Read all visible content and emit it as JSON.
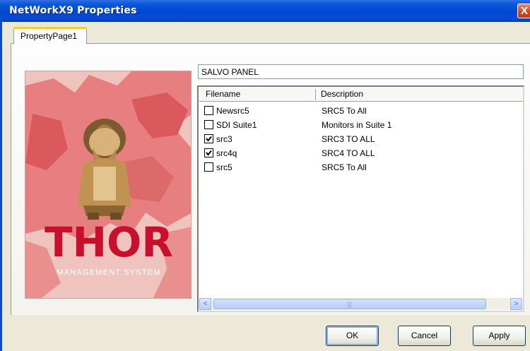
{
  "window": {
    "title": "NetWorkX9 Properties",
    "close_glyph": "X"
  },
  "tabs": [
    {
      "label": "PropertyPage1"
    }
  ],
  "logo": {
    "brand": "THOR",
    "tagline": "MANAGEMENT SYSTEM"
  },
  "panel_title": "SALVO PANEL",
  "list": {
    "columns": [
      "Filename",
      "Description"
    ],
    "rows": [
      {
        "filename": "Newsrc5",
        "description": "SRC5 To All",
        "checked": false
      },
      {
        "filename": "SDI Suite1",
        "description": "Monitors in Suite 1",
        "checked": false
      },
      {
        "filename": "src3",
        "description": "SRC3 TO ALL",
        "checked": true
      },
      {
        "filename": "src4q",
        "description": "SRC4 TO ALL",
        "checked": true
      },
      {
        "filename": "src5",
        "description": "SRC5 To All",
        "checked": false
      }
    ],
    "scroll_left": "<",
    "scroll_right": ">",
    "scroll_grip": "|||"
  },
  "buttons": {
    "ok": "OK",
    "cancel": "Cancel",
    "apply": "Apply"
  },
  "colors": {
    "titlebar": "#0046d3",
    "face": "#ece9d8",
    "logo_red": "#c8102e"
  }
}
